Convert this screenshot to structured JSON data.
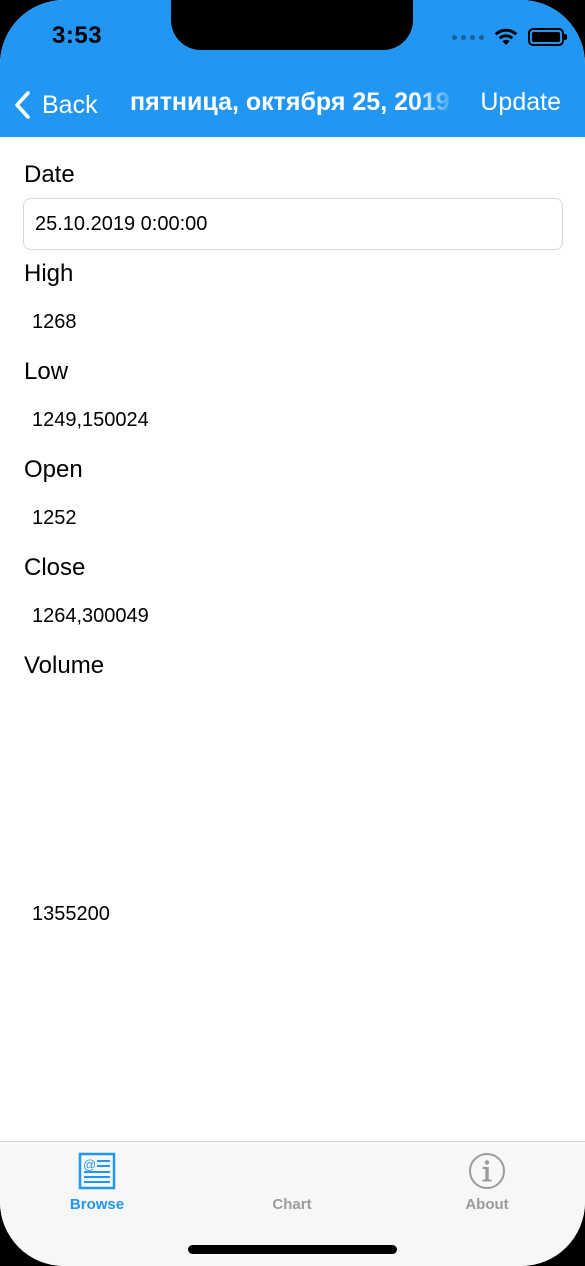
{
  "status_bar": {
    "time": "3:53"
  },
  "nav": {
    "back_label": "Back",
    "title": "пятница, октября 25, 2019",
    "update_label": "Update"
  },
  "fields": {
    "date": {
      "label": "Date",
      "value": "25.10.2019 0:00:00"
    },
    "high": {
      "label": "High",
      "value": "1268"
    },
    "low": {
      "label": "Low",
      "value": "1249,150024"
    },
    "open": {
      "label": "Open",
      "value": "1252"
    },
    "close": {
      "label": "Close",
      "value": "1264,300049"
    },
    "volume": {
      "label": "Volume",
      "value": "1355200"
    }
  },
  "tabs": [
    {
      "label": "Browse",
      "icon": "browse-icon",
      "active": true
    },
    {
      "label": "Chart",
      "icon": "",
      "active": false
    },
    {
      "label": "About",
      "icon": "info-icon",
      "active": false
    }
  ],
  "colors": {
    "accent": "#2196f3",
    "tab_inactive": "#9b9b9b"
  }
}
